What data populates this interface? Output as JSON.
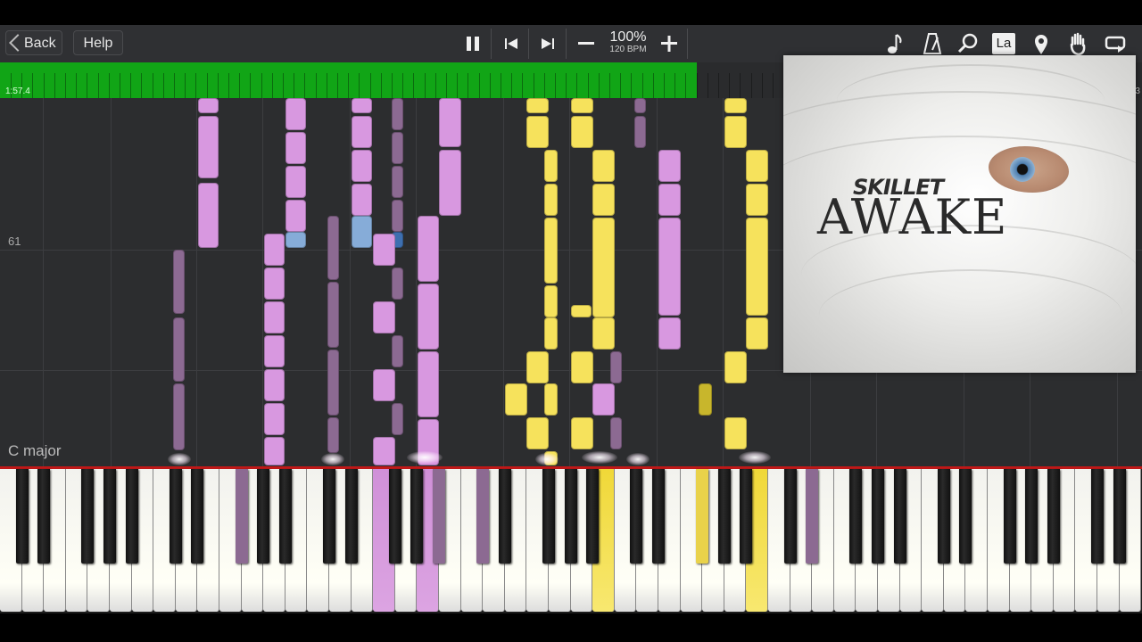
{
  "toolbar": {
    "back_label": "Back",
    "help_label": "Help",
    "tempo_percent": "100%",
    "tempo_bpm": "120 BPM",
    "icons": [
      "pause-icon",
      "skip-back-icon",
      "skip-forward-icon",
      "minus-icon",
      "plus-icon",
      "note-icon",
      "metronome-icon",
      "magnifier-icon",
      "la-icon",
      "location-pin-icon",
      "hand-icon",
      "loop-icon"
    ],
    "la_label": "La"
  },
  "progress": {
    "elapsed": "1:57.4",
    "total_suffix": ".3",
    "fraction": 0.61,
    "bar_color": "#11a516"
  },
  "roll": {
    "pitch_label": "61",
    "key_signature": "C major"
  },
  "colors": {
    "pink": "#d898e0",
    "dark_purple": "#8c6a92",
    "yellow": "#f6e25c",
    "light_blue": "#86acd8"
  },
  "album": {
    "band": "SKILLET",
    "title": "AWAKE"
  }
}
